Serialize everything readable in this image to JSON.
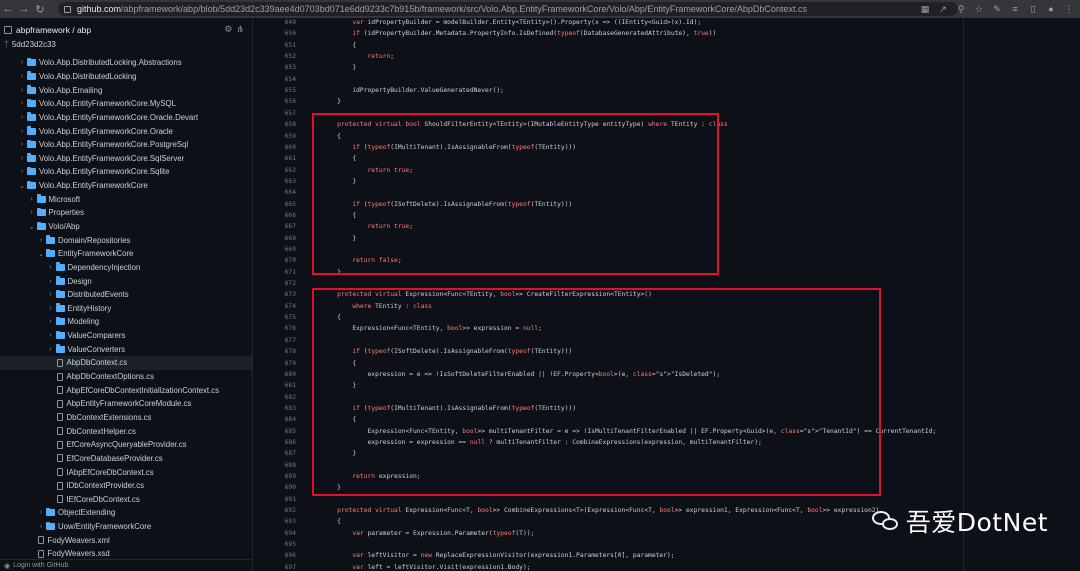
{
  "browser": {
    "url_host": "github.com",
    "url_path": "/abpframework/abp/blob/5dd23d2c339aee4d0703bd071e6dd9233c7b915b/framework/src/Volo.Abp.EntityFrameworkCore/Volo/Abp/EntityFrameworkCore/AbpDbContext.cs",
    "icons": [
      "back-icon",
      "forward-icon",
      "reload-icon",
      "translate-icon",
      "share-icon",
      "zoom-icon",
      "bookmark-star-icon",
      "extensions-icon",
      "reading-list-icon",
      "sidebar-icon",
      "profile-icon"
    ]
  },
  "sidebar": {
    "repo": "abpframework / abp",
    "branch": "5dd23d2c33",
    "footer": "Login with GitHub",
    "items": [
      {
        "label": "Volo.Abp.DistributedLocking.Abstractions",
        "type": "folder",
        "depth": 2,
        "open": false
      },
      {
        "label": "Volo.Abp.DistributedLocking",
        "type": "folder",
        "depth": 2,
        "open": false
      },
      {
        "label": "Volo.Abp.Emailing",
        "type": "folder",
        "depth": 2,
        "open": false
      },
      {
        "label": "Volo.Abp.EntityFrameworkCore.MySQL",
        "type": "folder",
        "depth": 2,
        "open": false
      },
      {
        "label": "Volo.Abp.EntityFrameworkCore.Oracle.Devart",
        "type": "folder",
        "depth": 2,
        "open": false
      },
      {
        "label": "Volo.Abp.EntityFrameworkCore.Oracle",
        "type": "folder",
        "depth": 2,
        "open": false
      },
      {
        "label": "Volo.Abp.EntityFrameworkCore.PostgreSql",
        "type": "folder",
        "depth": 2,
        "open": false
      },
      {
        "label": "Volo.Abp.EntityFrameworkCore.SqlServer",
        "type": "folder",
        "depth": 2,
        "open": false
      },
      {
        "label": "Volo.Abp.EntityFrameworkCore.Sqlite",
        "type": "folder",
        "depth": 2,
        "open": false
      },
      {
        "label": "Volo.Abp.EntityFrameworkCore",
        "type": "folder",
        "depth": 2,
        "open": true
      },
      {
        "label": "Microsoft",
        "type": "folder",
        "depth": 3,
        "open": false
      },
      {
        "label": "Properties",
        "type": "folder",
        "depth": 3,
        "open": false
      },
      {
        "label": "Volo/Abp",
        "type": "folder",
        "depth": 3,
        "open": true
      },
      {
        "label": "Domain/Repositories",
        "type": "folder",
        "depth": 4,
        "open": false
      },
      {
        "label": "EntityFrameworkCore",
        "type": "folder",
        "depth": 4,
        "open": true
      },
      {
        "label": "DependencyInjection",
        "type": "folder",
        "depth": 5,
        "open": false
      },
      {
        "label": "Design",
        "type": "folder",
        "depth": 5,
        "open": false
      },
      {
        "label": "DistributedEvents",
        "type": "folder",
        "depth": 5,
        "open": false
      },
      {
        "label": "EntityHistory",
        "type": "folder",
        "depth": 5,
        "open": false
      },
      {
        "label": "Modeling",
        "type": "folder",
        "depth": 5,
        "open": false
      },
      {
        "label": "ValueComparers",
        "type": "folder",
        "depth": 5,
        "open": false
      },
      {
        "label": "ValueConverters",
        "type": "folder",
        "depth": 5,
        "open": false
      },
      {
        "label": "AbpDbContext.cs",
        "type": "file",
        "depth": 5,
        "active": true
      },
      {
        "label": "AbpDbContextOptions.cs",
        "type": "file",
        "depth": 5
      },
      {
        "label": "AbpEfCoreDbContextInitializationContext.cs",
        "type": "file",
        "depth": 5
      },
      {
        "label": "AbpEntityFrameworkCoreModule.cs",
        "type": "file",
        "depth": 5
      },
      {
        "label": "DbContextExtensions.cs",
        "type": "file",
        "depth": 5
      },
      {
        "label": "DbContextHelper.cs",
        "type": "file",
        "depth": 5
      },
      {
        "label": "EfCoreAsyncQueryableProvider.cs",
        "type": "file",
        "depth": 5
      },
      {
        "label": "EfCoreDatabaseProvider.cs",
        "type": "file",
        "depth": 5
      },
      {
        "label": "IAbpEfCoreDbContext.cs",
        "type": "file",
        "depth": 5
      },
      {
        "label": "IDbContextProvider.cs",
        "type": "file",
        "depth": 5
      },
      {
        "label": "IEfCoreDbContext.cs",
        "type": "file",
        "depth": 5
      },
      {
        "label": "ObjectExtending",
        "type": "folder",
        "depth": 4,
        "open": false
      },
      {
        "label": "Uow/EntityFrameworkCore",
        "type": "folder",
        "depth": 4,
        "open": false
      },
      {
        "label": "FodyWeavers.xml",
        "type": "file",
        "depth": 3
      },
      {
        "label": "FodyWeavers.xsd",
        "type": "file",
        "depth": 3
      }
    ]
  },
  "code": {
    "lines": [
      {
        "n": "649",
        "text": "        var idPropertyBuilder = modelBuilder.Entity<TEntity>().Property(x => ((IEntity<Guid>)x).Id);"
      },
      {
        "n": "650",
        "text": "        if (idPropertyBuilder.Metadata.PropertyInfo.IsDefined(typeof(DatabaseGeneratedAttribute), true))"
      },
      {
        "n": "651",
        "text": "        {"
      },
      {
        "n": "652",
        "text": "            return;"
      },
      {
        "n": "653",
        "text": "        }"
      },
      {
        "n": "654",
        "text": ""
      },
      {
        "n": "655",
        "text": "        idPropertyBuilder.ValueGeneratedNever();"
      },
      {
        "n": "656",
        "text": "    }"
      },
      {
        "n": "657",
        "text": ""
      },
      {
        "n": "658",
        "text": "    protected virtual bool ShouldFilterEntity<TEntity>(IMutableEntityType entityType) where TEntity : class"
      },
      {
        "n": "659",
        "text": "    {"
      },
      {
        "n": "660",
        "text": "        if (typeof(IMultiTenant).IsAssignableFrom(typeof(TEntity)))"
      },
      {
        "n": "661",
        "text": "        {"
      },
      {
        "n": "662",
        "text": "            return true;"
      },
      {
        "n": "663",
        "text": "        }"
      },
      {
        "n": "664",
        "text": ""
      },
      {
        "n": "665",
        "text": "        if (typeof(ISoftDelete).IsAssignableFrom(typeof(TEntity)))"
      },
      {
        "n": "666",
        "text": "        {"
      },
      {
        "n": "667",
        "text": "            return true;"
      },
      {
        "n": "668",
        "text": "        }"
      },
      {
        "n": "669",
        "text": ""
      },
      {
        "n": "670",
        "text": "        return false;"
      },
      {
        "n": "671",
        "text": "    }"
      },
      {
        "n": "672",
        "text": ""
      },
      {
        "n": "673",
        "text": "    protected virtual Expression<Func<TEntity, bool>> CreateFilterExpression<TEntity>()"
      },
      {
        "n": "674",
        "text": "        where TEntity : class"
      },
      {
        "n": "675",
        "text": "    {"
      },
      {
        "n": "676",
        "text": "        Expression<Func<TEntity, bool>> expression = null;"
      },
      {
        "n": "677",
        "text": ""
      },
      {
        "n": "678",
        "text": "        if (typeof(ISoftDelete).IsAssignableFrom(typeof(TEntity)))"
      },
      {
        "n": "679",
        "text": "        {"
      },
      {
        "n": "680",
        "text": "            expression = e => !IsSoftDeleteFilterEnabled || !EF.Property<bool>(e, \"IsDeleted\");"
      },
      {
        "n": "681",
        "text": "        }"
      },
      {
        "n": "682",
        "text": ""
      },
      {
        "n": "683",
        "text": "        if (typeof(IMultiTenant).IsAssignableFrom(typeof(TEntity)))"
      },
      {
        "n": "684",
        "text": "        {"
      },
      {
        "n": "685",
        "text": "            Expression<Func<TEntity, bool>> multiTenantFilter = e => !IsMultiTenantFilterEnabled || EF.Property<Guid>(e, \"TenantId\") == CurrentTenantId;"
      },
      {
        "n": "686",
        "text": "            expression = expression == null ? multiTenantFilter : CombineExpressions(expression, multiTenantFilter);"
      },
      {
        "n": "687",
        "text": "        }"
      },
      {
        "n": "688",
        "text": ""
      },
      {
        "n": "689",
        "text": "        return expression;"
      },
      {
        "n": "690",
        "text": "    }"
      },
      {
        "n": "691",
        "text": ""
      },
      {
        "n": "692",
        "text": "    protected virtual Expression<Func<T, bool>> CombineExpressions<T>(Expression<Func<T, bool>> expression1, Expression<Func<T, bool>> expression2)"
      },
      {
        "n": "693",
        "text": "    {"
      },
      {
        "n": "694",
        "text": "        var parameter = Expression.Parameter(typeof(T));"
      },
      {
        "n": "695",
        "text": ""
      },
      {
        "n": "696",
        "text": "        var leftVisitor = new ReplaceExpressionVisitor(expression1.Parameters[0], parameter);"
      },
      {
        "n": "697",
        "text": "        var left = leftVisitor.Visit(expression1.Body);"
      }
    ]
  },
  "watermark": "吾爱DotNet",
  "colors": {
    "highlight_box": "#e3102b",
    "folder": "#54aeff",
    "keyword": "#ff7b72",
    "type": "#d2a8ff",
    "string": "#a5d6ff"
  }
}
